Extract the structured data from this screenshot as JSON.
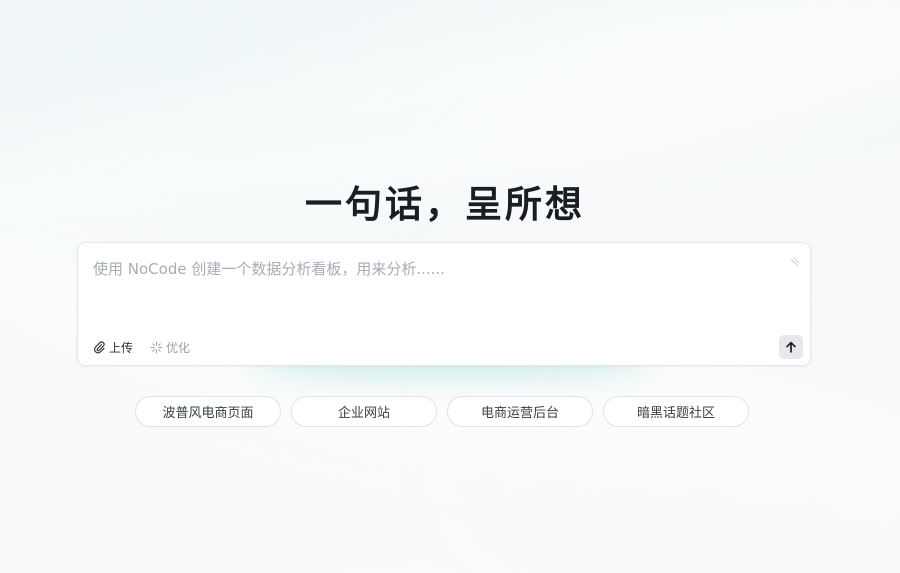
{
  "hero": {
    "title": "一句话，呈所想"
  },
  "prompt": {
    "placeholder": "使用 NoCode 创建一个数据分析看板，用来分析......",
    "value": "",
    "upload_label": "上传",
    "optimize_label": "优化",
    "upload_icon": "paperclip-icon",
    "optimize_icon": "sparkle-icon",
    "send_icon": "arrow-up-icon",
    "resize_icon": "resize-handle-icon"
  },
  "suggestions": [
    {
      "label": "波普风电商页面"
    },
    {
      "label": "企业网站"
    },
    {
      "label": "电商运营后台"
    },
    {
      "label": "暗黑话题社区"
    }
  ],
  "colors": {
    "title": "#1a1d21",
    "placeholder": "#a7adb5",
    "accent_glow": "#78d2c8",
    "chip_border": "#dfe3e7"
  }
}
